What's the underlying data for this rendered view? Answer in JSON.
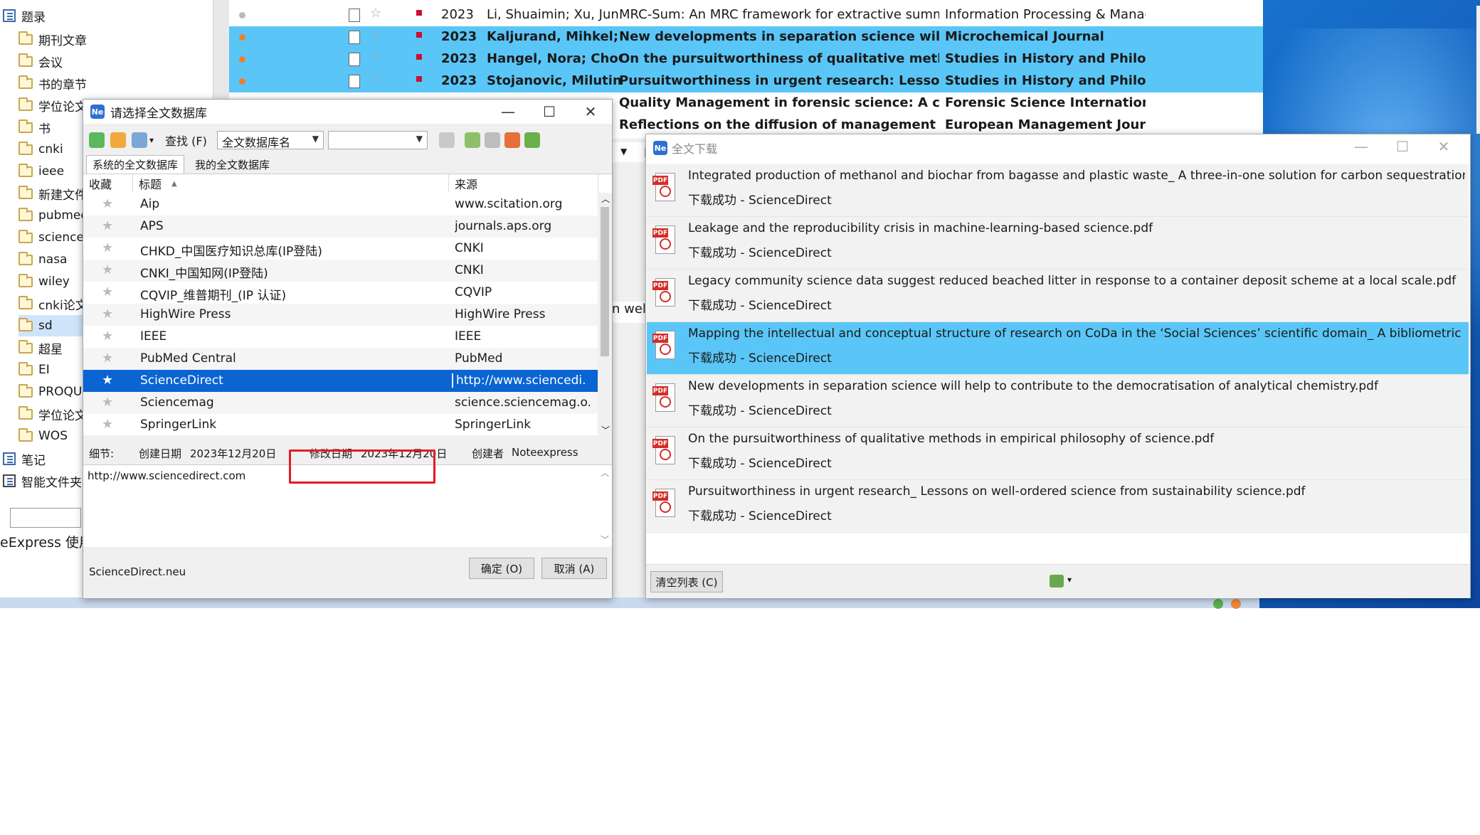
{
  "tree": {
    "root_label": "题录",
    "folders": [
      "期刊文章",
      "会议",
      "书的章节",
      "学位论文",
      "书",
      "cnki",
      "ieee",
      "新建文件",
      "pubmed",
      "science",
      "nasa",
      "wiley",
      "cnki论文",
      "sd",
      "超星",
      "EI",
      "PROQU",
      "学位论文",
      "WOS"
    ],
    "notes_label": "笔记",
    "smart_label": "智能文件夹",
    "status_left": "eExpress  使用"
  },
  "records": [
    {
      "year": "2023",
      "authors": "Li, Shuaimin; Xu, Jun...",
      "title": "MRC-Sum: An MRC framework for extractive summarization of academic...",
      "journal": "Information Processing & Manag..."
    },
    {
      "year": "2023",
      "authors": "Kaljurand, Mihkel; R",
      "title": "New developments in separation science will help to contribute to the",
      "journal": "Microchemical Journal"
    },
    {
      "year": "2023",
      "authors": "Hangel, Nora; ChoG",
      "title": "On the pursuitworthiness of qualitative methods in empirical philosop",
      "journal": "Studies in History and Philosoph"
    },
    {
      "year": "2023",
      "authors": "Stojanovic, Milutin",
      "title": "Pursuitworthiness in urgent research: Lessons on well-ordered science",
      "journal": "Studies in History and Philosoph"
    },
    {
      "title": "Quality Management in forensic science: A closer inspection",
      "journal": "Forensic Science International"
    },
    {
      "title": "Reflections on the diffusion of management and organization researc",
      "journal": "European Management Journal"
    }
  ],
  "partial_text": "n well-",
  "dialog1": {
    "title": "请选择全文数据库",
    "search_label": "查找 (F)",
    "field_combo": "全文数据库名",
    "tab_system": "系统的全文数据库",
    "tab_mine": "我的全文数据库",
    "col_fav": "收藏",
    "col_title": "标题",
    "col_source": "来源",
    "rows": [
      {
        "name": "Aip",
        "source": "www.scitation.org"
      },
      {
        "name": "APS",
        "source": "journals.aps.org"
      },
      {
        "name": "CHKD_中国医疗知识总库(IP登陆)",
        "source": "CNKI"
      },
      {
        "name": "CNKI_中国知网(IP登陆)",
        "source": "CNKI"
      },
      {
        "name": "CQVIP_维普期刊_(IP 认证)",
        "source": "CQVIP"
      },
      {
        "name": "HighWire Press",
        "source": "HighWire Press"
      },
      {
        "name": "IEEE",
        "source": "IEEE"
      },
      {
        "name": "PubMed Central",
        "source": "PubMed"
      },
      {
        "name": "ScienceDirect",
        "source": "http://www.sciencedi..."
      },
      {
        "name": "Sciencemag",
        "source": "science.sciencemag.o..."
      },
      {
        "name": "SpringerLink",
        "source": "SpringerLink"
      }
    ],
    "detail_label": "细节:",
    "created_label": "创建日期",
    "created_value": "2023年12月20日",
    "modified_label": "修改日期",
    "modified_value": "2023年12月20日",
    "creator_label": "创建者",
    "creator_value": "Noteexpress",
    "url": "http://www.sciencedirect.com",
    "file_name": "ScienceDirect.neu",
    "ok_label": "确定 (O)",
    "cancel_label": "取消 (A)"
  },
  "dialog2": {
    "title": "全文下载",
    "items": [
      {
        "title": "Integrated production of methanol and biochar from bagasse and plastic waste_ A three-in-one solution for carbon sequestration, bioener...",
        "status": "下载成功  -  ScienceDirect"
      },
      {
        "title": "Leakage and the reproducibility crisis in machine-learning-based science.pdf",
        "status": "下载成功  -  ScienceDirect"
      },
      {
        "title": "Legacy community science data suggest reduced beached litter in response to a container deposit scheme at a local scale.pdf",
        "status": "下载成功  -  ScienceDirect"
      },
      {
        "title": "Mapping the intellectual and conceptual structure of research on CoDa in the   ‘Social Sciences’   scientific domain_ A bibliometric overvi...",
        "status": "下载成功  -  ScienceDirect"
      },
      {
        "title": "New developments in separation science will help to contribute to the democratisation of analytical chemistry.pdf",
        "status": "下载成功  -  ScienceDirect"
      },
      {
        "title": "On the pursuitworthiness of qualitative methods in empirical philosophy of science.pdf",
        "status": "下载成功  -  ScienceDirect"
      },
      {
        "title": "Pursuitworthiness in urgent research_ Lessons on well-ordered science from sustainability science.pdf",
        "status": "下载成功  -  ScienceDirect"
      }
    ],
    "clear_label": "清空列表 (C)"
  },
  "colors": {
    "highlight": "#5ac6f7",
    "selection": "#0a64d2",
    "annotation": "#e31b23"
  }
}
